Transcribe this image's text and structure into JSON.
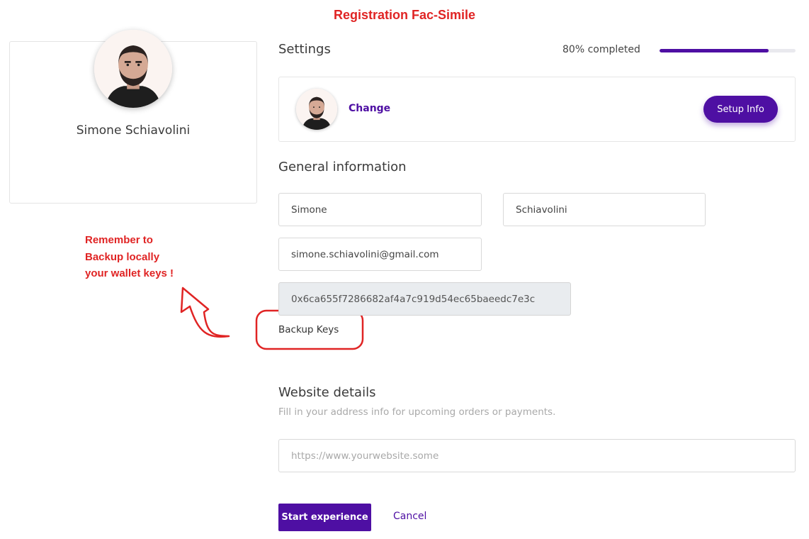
{
  "banner": {
    "title": "Registration Fac-Simile"
  },
  "profile": {
    "name": "Simone Schiavolini",
    "avatar_icon": "user-avatar-photo"
  },
  "annotation": {
    "lines": [
      "Remember to",
      "Backup locally",
      "your wallet keys !"
    ],
    "color": "#e02424"
  },
  "settings": {
    "title": "Settings",
    "progress_label": "80% completed",
    "progress_fraction": 0.8,
    "change_label": "Change",
    "setup_button": "Setup Info"
  },
  "general": {
    "title": "General information",
    "first_name": "Simone",
    "last_name": "Schiavolini",
    "email": "simone.schiavolini@gmail.com",
    "wallet_address": "0x6ca655f7286682af4a7c919d54ec65baeedc7e3c",
    "backup_label": "Backup Keys"
  },
  "website": {
    "title": "Website details",
    "subtitle": "Fill in your address info for upcoming orders or payments.",
    "placeholder": "https://www.yourwebsite.some"
  },
  "actions": {
    "start_button": "Start experience",
    "cancel_label": "Cancel"
  },
  "colors": {
    "accent": "#4e0fa3",
    "annotation": "#e02424"
  }
}
